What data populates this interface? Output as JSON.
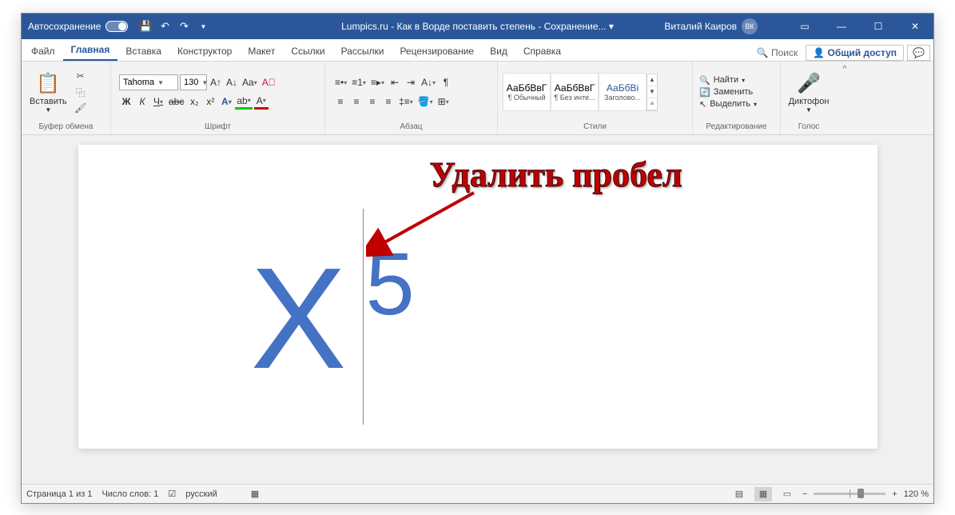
{
  "titlebar": {
    "autosave": "Автосохранение",
    "doc_title": "Lumpics.ru - Как в Ворде поставить степень - Сохранение... ▾",
    "username": "Виталий Каиров",
    "avatar": "ВК"
  },
  "tabs": {
    "file": "Файл",
    "home": "Главная",
    "insert": "Вставка",
    "design": "Конструктор",
    "layout": "Макет",
    "references": "Ссылки",
    "mailings": "Рассылки",
    "review": "Рецензирование",
    "view": "Вид",
    "help": "Справка",
    "search": "Поиск",
    "share": "Общий доступ",
    "comments_icon": "💬"
  },
  "ribbon": {
    "clipboard": {
      "paste": "Вставить",
      "label": "Буфер обмена"
    },
    "font": {
      "name": "Tahoma",
      "size": "130",
      "bold": "Ж",
      "italic": "К",
      "underline": "Ч",
      "strike": "abc",
      "sub": "x₂",
      "sup": "x²",
      "label": "Шрифт"
    },
    "paragraph": {
      "label": "Абзац"
    },
    "styles": {
      "sample": "АаБбВвГ",
      "sample_h": "АаБбВі",
      "s1": "¶ Обычный",
      "s2": "¶ Без инте...",
      "s3": "Заголово...",
      "label": "Стили"
    },
    "editing": {
      "find": "Найти",
      "replace": "Заменить",
      "select": "Выделить",
      "label": "Редактирование"
    },
    "voice": {
      "dictate": "Диктофон",
      "label": "Голос"
    }
  },
  "document": {
    "x": "X",
    "sup": "5",
    "annotation": "Удалить пробел"
  },
  "statusbar": {
    "page": "Страница 1 из 1",
    "words": "Число слов: 1",
    "lang": "русский",
    "zoom": "120 %"
  }
}
